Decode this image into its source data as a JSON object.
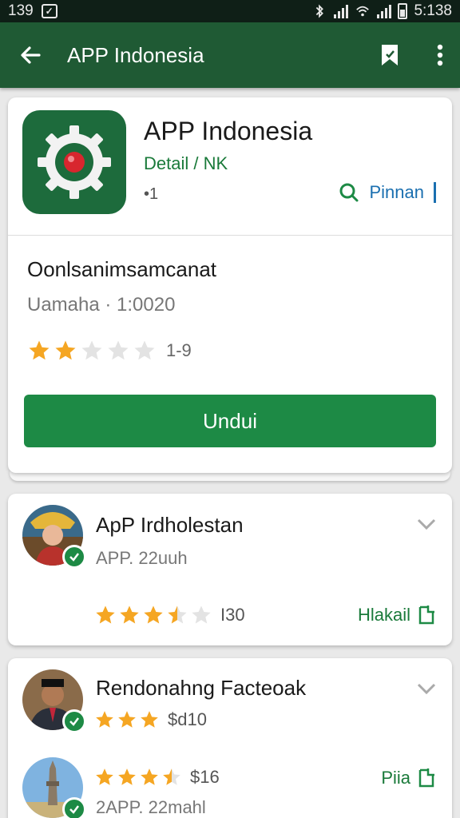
{
  "status_bar": {
    "time_left": "139",
    "time_right": "5:138"
  },
  "app_bar": {
    "title": "APP Indonesia"
  },
  "main_card": {
    "app_name": "APP Indonesia",
    "developer": "Detail / NK",
    "dot_count": "•1",
    "wishlist_label": "Pinnan",
    "category": "Oonlsanimsamcanat",
    "size": "Uamaha · 1:0020",
    "rating": 2,
    "rating_max": 5,
    "rating_count": "1-9",
    "install_label": "Undui"
  },
  "reviews": [
    {
      "name": "ApP Irdholestan",
      "sub": "APP. 22uuh",
      "rating": 3.5,
      "rating_count": "I30",
      "action_label": "Hlakail"
    },
    {
      "name": "Rendonahng Facteoak",
      "rating": 3,
      "rating_count": "$d10",
      "rating_2": 3.5,
      "rating_count_2": "$16",
      "action_label": "Piia",
      "sub": "2APP. 22mahl"
    }
  ],
  "colors": {
    "app_bar": "#1f5a34",
    "accent_green": "#1d8a45",
    "link_blue": "#1a6fb0",
    "star": "#f5a623"
  }
}
